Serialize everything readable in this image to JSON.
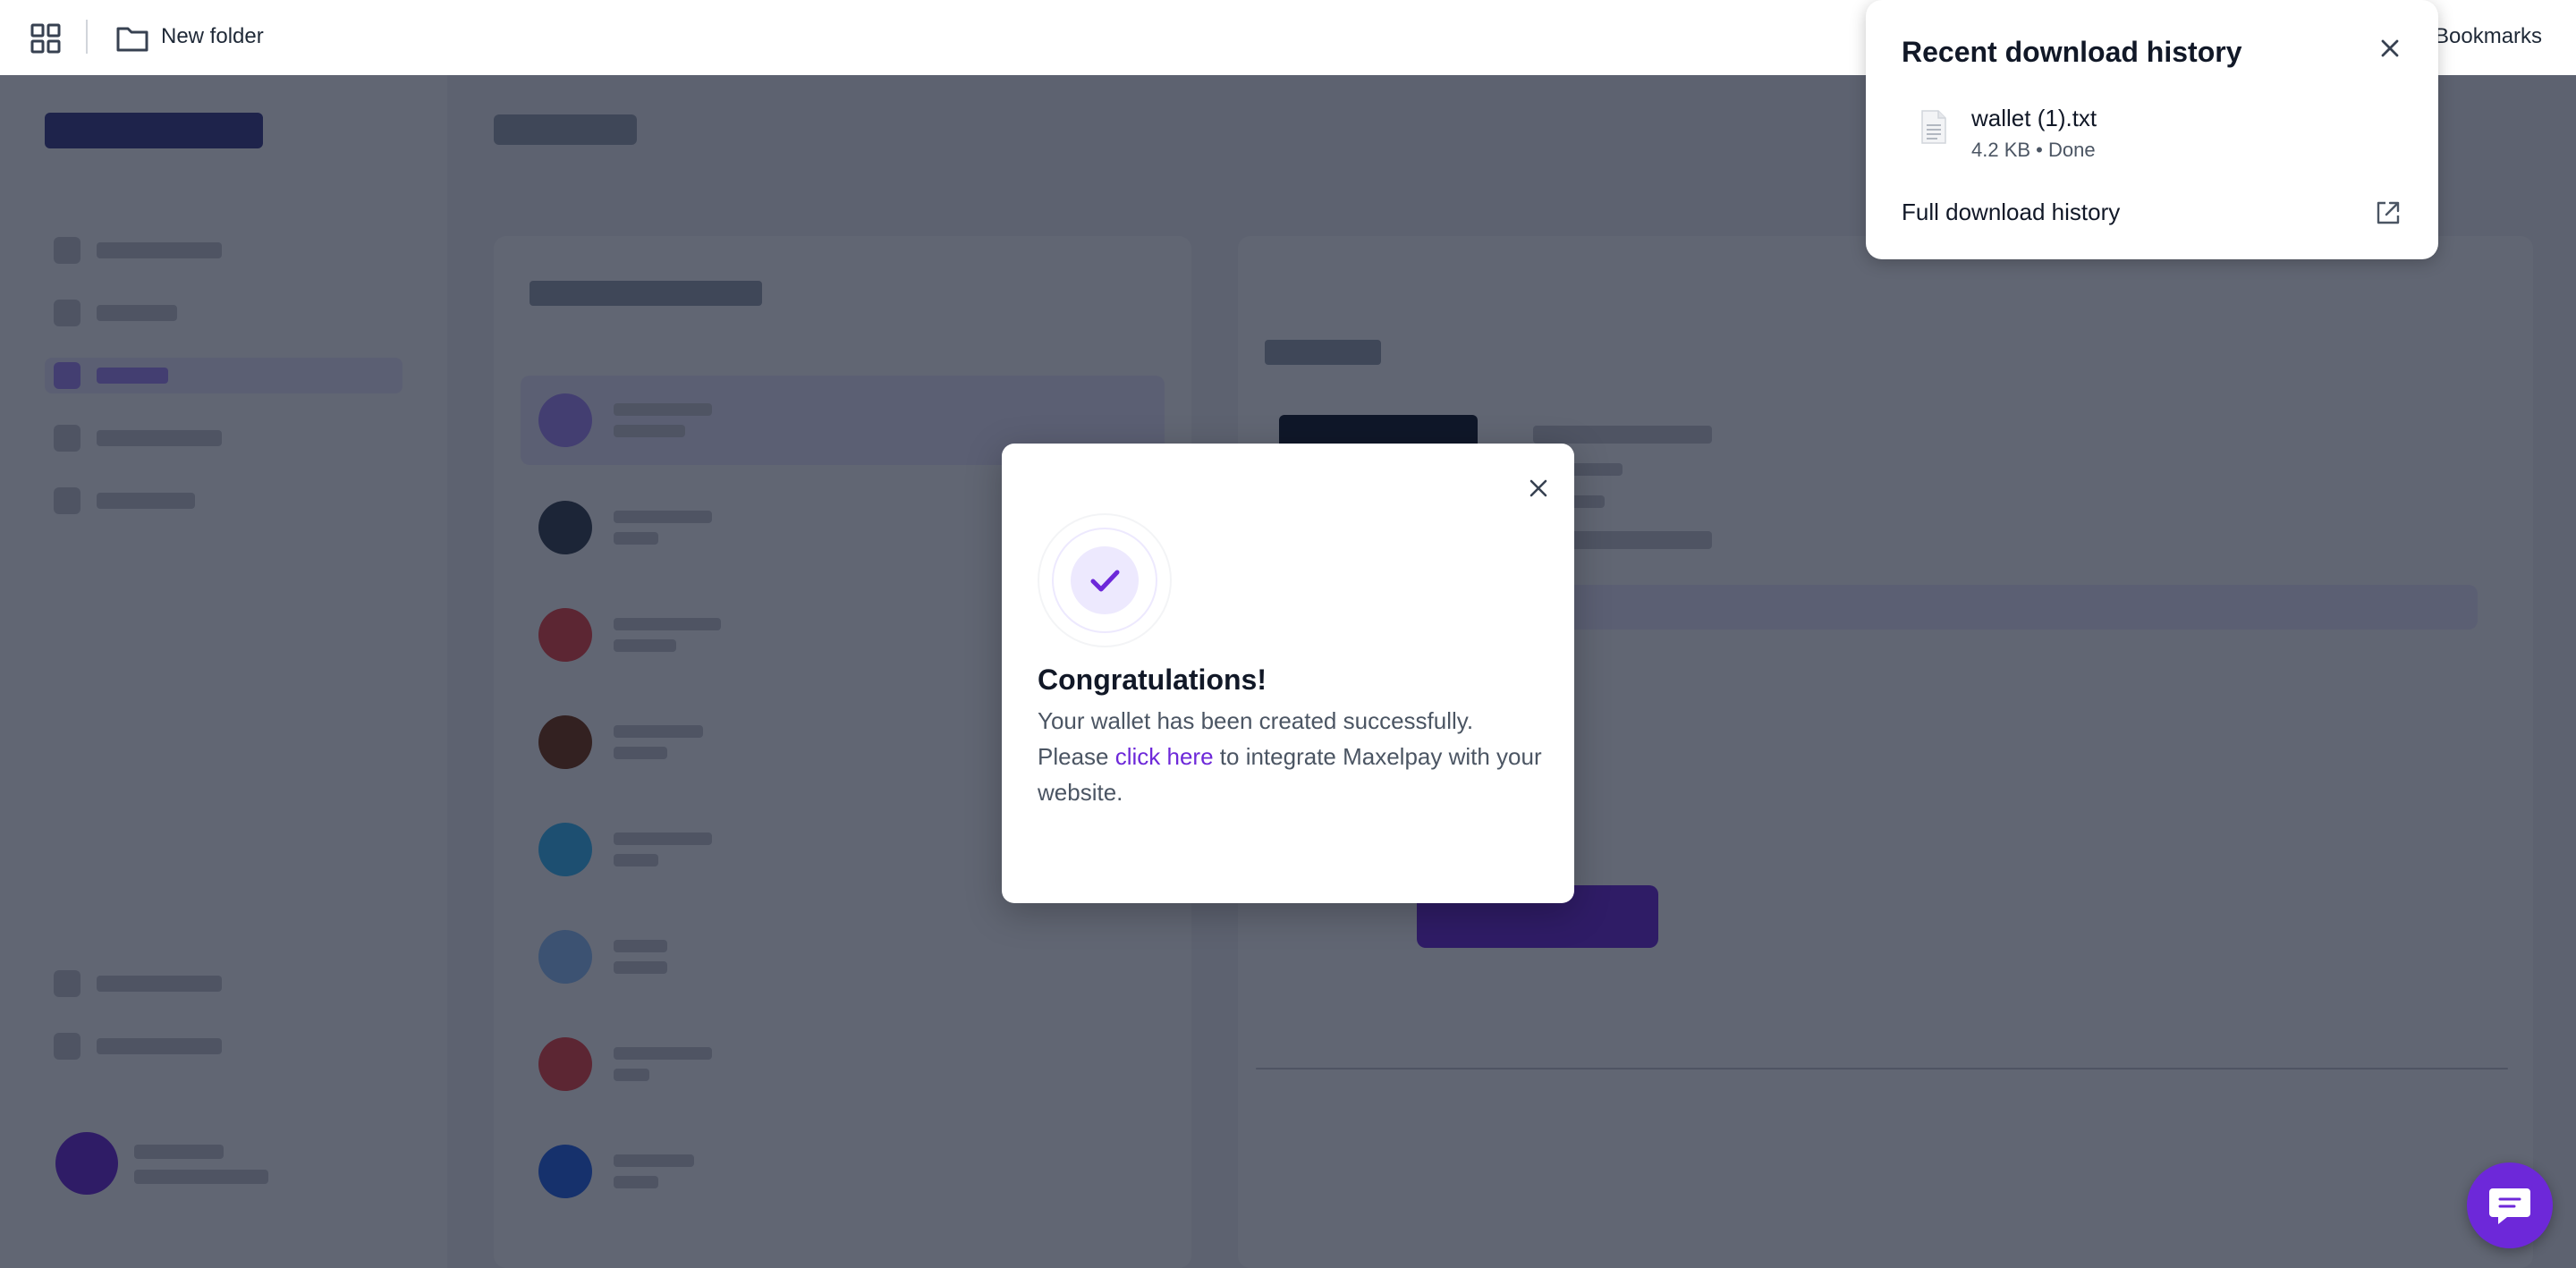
{
  "browser": {
    "bookmarks_bar": {
      "apps_icon": "apps-grid-icon",
      "folder_icon": "folder-icon",
      "folder_label": "New folder",
      "bookmarks_label": "Bookmarks"
    }
  },
  "download_popup": {
    "title": "Recent download history",
    "close_icon": "close-icon",
    "item": {
      "file_icon": "file-icon",
      "name": "wallet (1).txt",
      "meta": "4.2 KB • Done"
    },
    "full_history_label": "Full download history",
    "full_history_icon": "external-link-icon"
  },
  "modal": {
    "close_icon": "close-icon",
    "success_icon": "check-icon",
    "title": "Congratulations!",
    "text_before_link": "Your wallet has been created successfully. Please ",
    "link_text": "click here",
    "text_after_link": " to integrate Maxelpay with your website."
  },
  "chat": {
    "icon": "chat-bubble-icon"
  },
  "colors": {
    "accent": "#6d28d9",
    "accent_light": "#ede9fe",
    "overlay": "rgba(15,23,42,0.66)"
  }
}
